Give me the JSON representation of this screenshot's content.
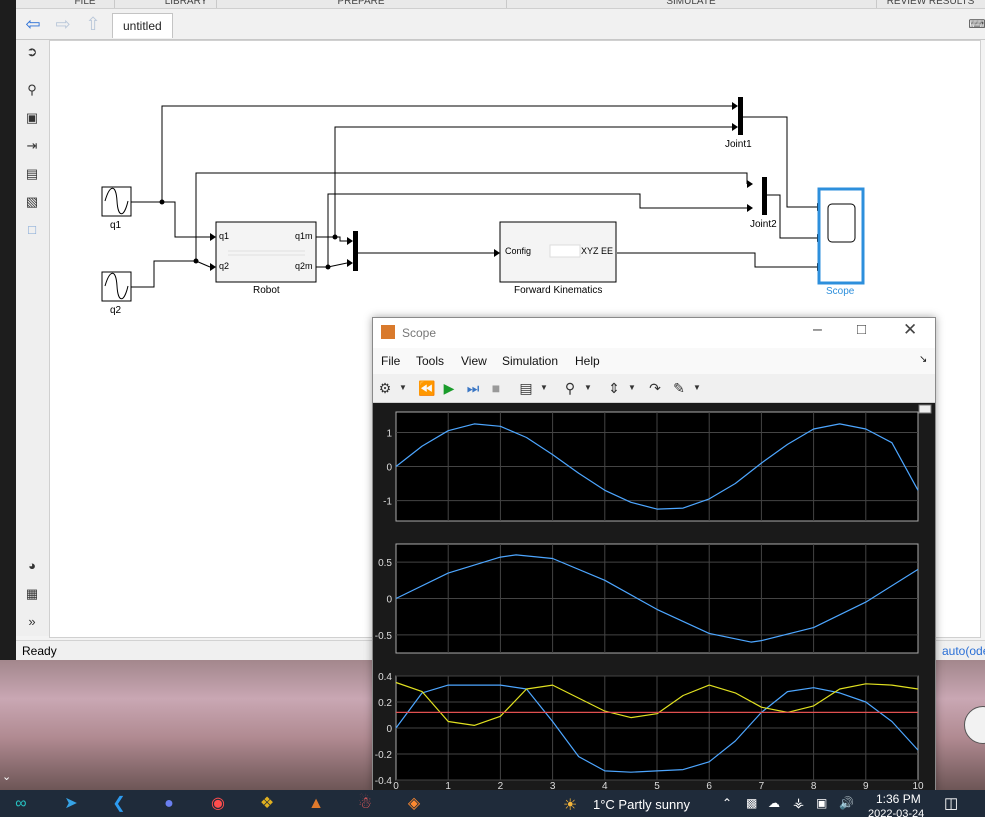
{
  "toolstrip": {
    "tabs": [
      "FILE",
      "LIBRARY",
      "PREPARE",
      "SIMULATE",
      "REVIEW RESULTS"
    ]
  },
  "model_tab": "untitled",
  "status": {
    "left": "Ready",
    "right": "auto(ode"
  },
  "blocks": {
    "q1": "q1",
    "q2": "q2",
    "robot": {
      "name": "Robot",
      "in1": "q1",
      "in2": "q2",
      "out1": "q1m",
      "out2": "q2m"
    },
    "fk": {
      "name": "Forward Kinematics",
      "in": "Config",
      "out": "XYZ EE"
    },
    "joint1": "Joint1",
    "joint2": "Joint2",
    "scope": "Scope"
  },
  "scope_window": {
    "title": "Scope",
    "menu": [
      "File",
      "Tools",
      "View",
      "Simulation",
      "Help"
    ]
  },
  "chart_data": [
    {
      "type": "line",
      "title": "",
      "xlim": [
        0,
        10
      ],
      "ylim": [
        -1.6,
        1.6
      ],
      "yticks": [
        "1",
        "0",
        "-1"
      ],
      "grid": true,
      "series": [
        {
          "color": "#4da6ff",
          "x": [
            0,
            0.5,
            1,
            1.5,
            2,
            2.5,
            3,
            3.5,
            4,
            4.5,
            5,
            5.5,
            6,
            6.5,
            7,
            7.5,
            8,
            8.5,
            9,
            9.5,
            10
          ],
          "values": [
            0,
            0.6,
            1.05,
            1.25,
            1.18,
            0.85,
            0.35,
            -0.2,
            -0.7,
            -1.05,
            -1.25,
            -1.22,
            -0.95,
            -0.5,
            0.1,
            0.65,
            1.1,
            1.25,
            1.1,
            0.7,
            -0.7
          ]
        }
      ]
    },
    {
      "type": "line",
      "title": "",
      "xlim": [
        0,
        10
      ],
      "ylim": [
        -0.75,
        0.75
      ],
      "yticks": [
        "0.5",
        "0",
        "-0.5"
      ],
      "grid": true,
      "series": [
        {
          "color": "#4da6ff",
          "x": [
            0,
            1,
            2,
            2.3,
            3,
            4,
            5,
            6,
            6.8,
            7,
            8,
            9,
            10
          ],
          "values": [
            0,
            0.35,
            0.57,
            0.6,
            0.55,
            0.25,
            -0.15,
            -0.48,
            -0.6,
            -0.58,
            -0.4,
            -0.05,
            0.4
          ]
        }
      ]
    },
    {
      "type": "line",
      "title": "",
      "xlim": [
        0,
        10
      ],
      "ylim": [
        -0.4,
        0.4
      ],
      "yticks": [
        "0.4",
        "0.2",
        "0",
        "-0.2",
        "-0.4"
      ],
      "xticks": [
        "0",
        "1",
        "2",
        "3",
        "4",
        "5",
        "6",
        "7",
        "8",
        "9",
        "10"
      ],
      "grid": true,
      "series": [
        {
          "color": "#4da6ff",
          "x": [
            0,
            0.5,
            1,
            1.5,
            2,
            2.5,
            3,
            3.5,
            4,
            4.5,
            5,
            5.5,
            6,
            6.5,
            7,
            7.5,
            8,
            8.5,
            9,
            9.5,
            10
          ],
          "values": [
            0,
            0.27,
            0.33,
            0.33,
            0.33,
            0.3,
            0.05,
            -0.22,
            -0.33,
            -0.34,
            -0.33,
            -0.32,
            -0.26,
            -0.1,
            0.12,
            0.28,
            0.31,
            0.27,
            0.2,
            0.05,
            -0.17
          ]
        },
        {
          "color": "#e0e020",
          "x": [
            0,
            0.5,
            1,
            1.5,
            2,
            2.5,
            3,
            3.5,
            4,
            4.5,
            5,
            5.5,
            6,
            6.5,
            7,
            7.5,
            8,
            8.5,
            9,
            9.5,
            10
          ],
          "values": [
            0.35,
            0.28,
            0.05,
            0.02,
            0.09,
            0.3,
            0.33,
            0.23,
            0.13,
            0.08,
            0.11,
            0.25,
            0.33,
            0.27,
            0.16,
            0.12,
            0.17,
            0.3,
            0.34,
            0.33,
            0.3
          ]
        },
        {
          "color": "#e05050",
          "x": [
            0,
            10
          ],
          "values": [
            0.12,
            0.12
          ]
        }
      ]
    }
  ],
  "taskbar": {
    "weather": "1°C  Partly sunny",
    "time": "1:36 PM",
    "date": "2022-03-24"
  }
}
